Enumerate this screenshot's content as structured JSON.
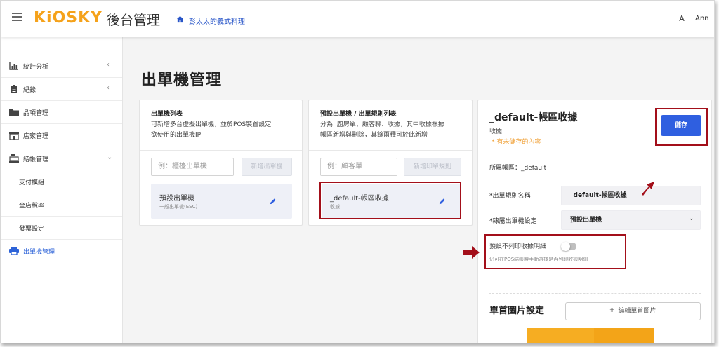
{
  "header": {
    "logo": "KiOSKY",
    "admin_title": "後台管理",
    "store_name": "彭太太的義式料理",
    "avatar_letter": "A",
    "user_name": "Ann"
  },
  "sidebar": {
    "items": [
      {
        "label": "統計分析",
        "icon": "chart-icon"
      },
      {
        "label": "紀錄",
        "icon": "clipboard-icon"
      },
      {
        "label": "品項管理",
        "icon": "folder-icon"
      },
      {
        "label": "店家管理",
        "icon": "store-icon"
      },
      {
        "label": "結帳管理",
        "icon": "register-icon"
      },
      {
        "label": "支付模組"
      },
      {
        "label": "全店稅率"
      },
      {
        "label": "發票設定"
      },
      {
        "label": "出單機管理",
        "icon": "printer-icon"
      }
    ]
  },
  "page_title": "出單機管理",
  "printer_list": {
    "title": "出單機列表",
    "desc_line1": "可新增多台虛擬出單機，並於POS裝置設定",
    "desc_line2": "欲使用的出單機IP",
    "input_placeholder": "例：櫃檯出單機",
    "add_button": "新增出單機",
    "items": [
      {
        "name": "預設出單機",
        "sub": "一般出單機(ESC)"
      }
    ]
  },
  "rule_list": {
    "title": "預設出單機 / 出單規則列表",
    "desc_line1": "分為: 廚房單、顧客聯、收據，其中收據根據",
    "desc_line2": "帳區新增與刪除，其餘兩種可於此新增",
    "input_placeholder": "例：顧客單",
    "add_button": "新增印單規則",
    "items": [
      {
        "name": "_default-帳區收據",
        "sub": "收據"
      }
    ]
  },
  "detail": {
    "title": "_default-帳區收據",
    "subtitle": "收據",
    "unsaved_notice": "* 有未儲存的內容",
    "save_button": "儲存",
    "account_zone": "所屬帳區：_default",
    "rule_name_label": "*出單規則名稱",
    "rule_name_value": "_default-帳區收據",
    "printer_label": "*隸屬出單機設定",
    "printer_value": "預設出單機",
    "no_print_label": "預設不列印收據明細",
    "no_print_hint": "仍可在POS結帳時手動選擇是否列印收據明細",
    "no_print_enabled": false,
    "header_image_title": "單首圖片設定",
    "edit_image_button": "編輯單首圖片"
  },
  "colors": {
    "brand": "#f5a21b",
    "primary": "#2f5fe0",
    "annotation": "#a30f1a",
    "warning": "#f0a23a"
  }
}
